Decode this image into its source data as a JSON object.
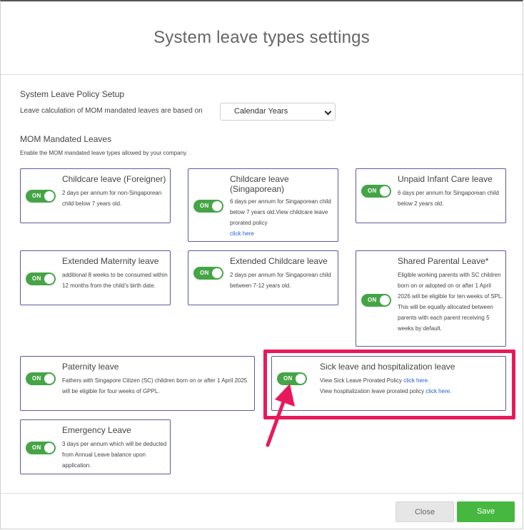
{
  "modal": {
    "title": "System leave types settings"
  },
  "policy": {
    "section_title": "System Leave Policy Setup",
    "calc_label": "Leave calculation of MOM mandated leaves are based on",
    "calc_value": "Calendar Years"
  },
  "mom": {
    "section_title": "MOM Mandated Leaves",
    "subtitle": "Enable the MOM mandated leave types allowed by your company."
  },
  "toggle_label": "ON",
  "cards": {
    "childcare_foreigner": {
      "title": "Childcare leave (Foreigner)",
      "desc": "2 days per annum for non-Singaporean child below 7 years old."
    },
    "childcare_singaporean": {
      "title": "Childcare leave (Singaporean)",
      "desc": "6 days per annum for Singaporean child below 7 years old.View childcare leave prorated policy",
      "link": "click here"
    },
    "unpaid_infant": {
      "title": "Unpaid Infant Care leave",
      "desc": "6 days per annum for Singaporean child below 2 years old."
    },
    "extended_maternity": {
      "title": "Extended Maternity leave",
      "desc": "additional 8 weeks to be consumed within 12 months from the child's birth date."
    },
    "extended_childcare": {
      "title": "Extended Childcare leave",
      "desc": "2 days per annum for Singaporean child between 7-12 years old."
    },
    "shared_parental": {
      "title": "Shared Parental Leave*",
      "desc": "Eligible working parents with SC children born on or adopted on or after 1 April 2026 will be eligible for ten weeks of SPL. This will be equally allocated between parents with each parent receiving 5 weeks by default."
    },
    "paternity": {
      "title": "Paternity leave",
      "desc": "Fathers with Singapore Citizen (SC) children born on or after 1 April 2025 will be eligible for four weeks of GPPL."
    },
    "sick_hospitalization": {
      "title": "Sick leave and hospitalization leave",
      "line1": "View Sick Leave Prorated Policy",
      "line1_link": "click here.",
      "line2": "View hospitalization leave prorated policy",
      "line2_link": "click here."
    },
    "emergency": {
      "title": "Emergency Leave",
      "desc": "3 days per annum which will be deducted from Annual Leave balance upon application."
    }
  },
  "footer": {
    "close_label": "Close",
    "save_label": "Save"
  },
  "colors": {
    "toggle_on": "#46a447",
    "card_border": "#5a5aa0",
    "highlight": "#e8195a",
    "save_button": "#46b83f",
    "link": "#1f5fd0"
  }
}
